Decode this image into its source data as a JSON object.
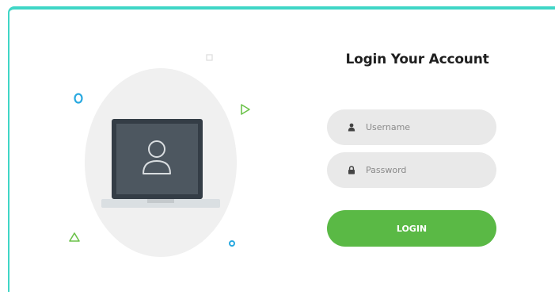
{
  "login": {
    "title": "Login Your Account",
    "username_placeholder": "Username",
    "password_placeholder": "Password",
    "button_label": "LOGIN"
  },
  "icons": {
    "username": "user-icon",
    "password": "lock-icon",
    "laptop": "laptop-user-icon"
  },
  "colors": {
    "accent_border": "#3fd6c6",
    "login_button": "#5ab945",
    "input_background": "#e9e9e9",
    "deco_blue": "#29a9e0",
    "deco_green": "#6cc24a"
  }
}
